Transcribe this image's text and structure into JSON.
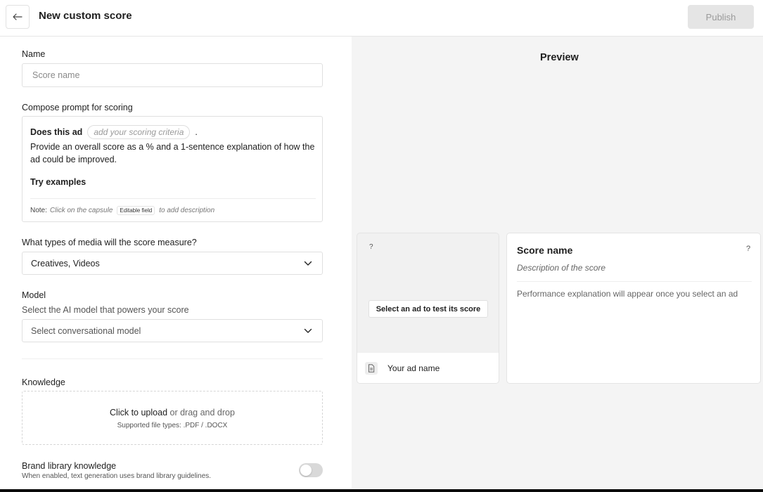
{
  "header": {
    "title": "New custom score",
    "publish_label": "Publish"
  },
  "form": {
    "name_label": "Name",
    "name_placeholder": "Score name",
    "prompt_label": "Compose prompt for scoring",
    "prompt": {
      "lead": "Does this ad",
      "capsule_placeholder": "add your scoring criteria",
      "period": ".",
      "body": "Provide an overall score as a % and a 1-sentence explanation of how the ad could be improved.",
      "try_examples": "Try examples",
      "note_prefix": "Note:",
      "note_click": "Click on the capsule",
      "note_tag": "Editable field",
      "note_suffix": "to add description"
    },
    "media_label": "What types of media will the score measure?",
    "media_value": "Creatives, Videos",
    "model_label": "Model",
    "model_sublabel": "Select the AI model that powers your score",
    "model_value": "Select conversational model",
    "knowledge_label": "Knowledge",
    "upload_link": "Click to upload",
    "upload_rest": "or drag and drop",
    "upload_types": "Supported file types: .PDF / .DOCX",
    "brand_title": "Brand library knowledge",
    "brand_desc": "When enabled, text generation uses brand library guidelines.",
    "brand_toggle_on": false
  },
  "preview": {
    "title": "Preview",
    "ad_card": {
      "question": "?",
      "select_label": "Select an ad to test its score",
      "ad_name": "Your ad name"
    },
    "score_card": {
      "title": "Score name",
      "question": "?",
      "description": "Description of the score",
      "performance": "Performance explanation will appear once you select an ad"
    }
  },
  "icons": [
    "arrow-left-icon",
    "chevron-down-icon",
    "document-icon"
  ]
}
